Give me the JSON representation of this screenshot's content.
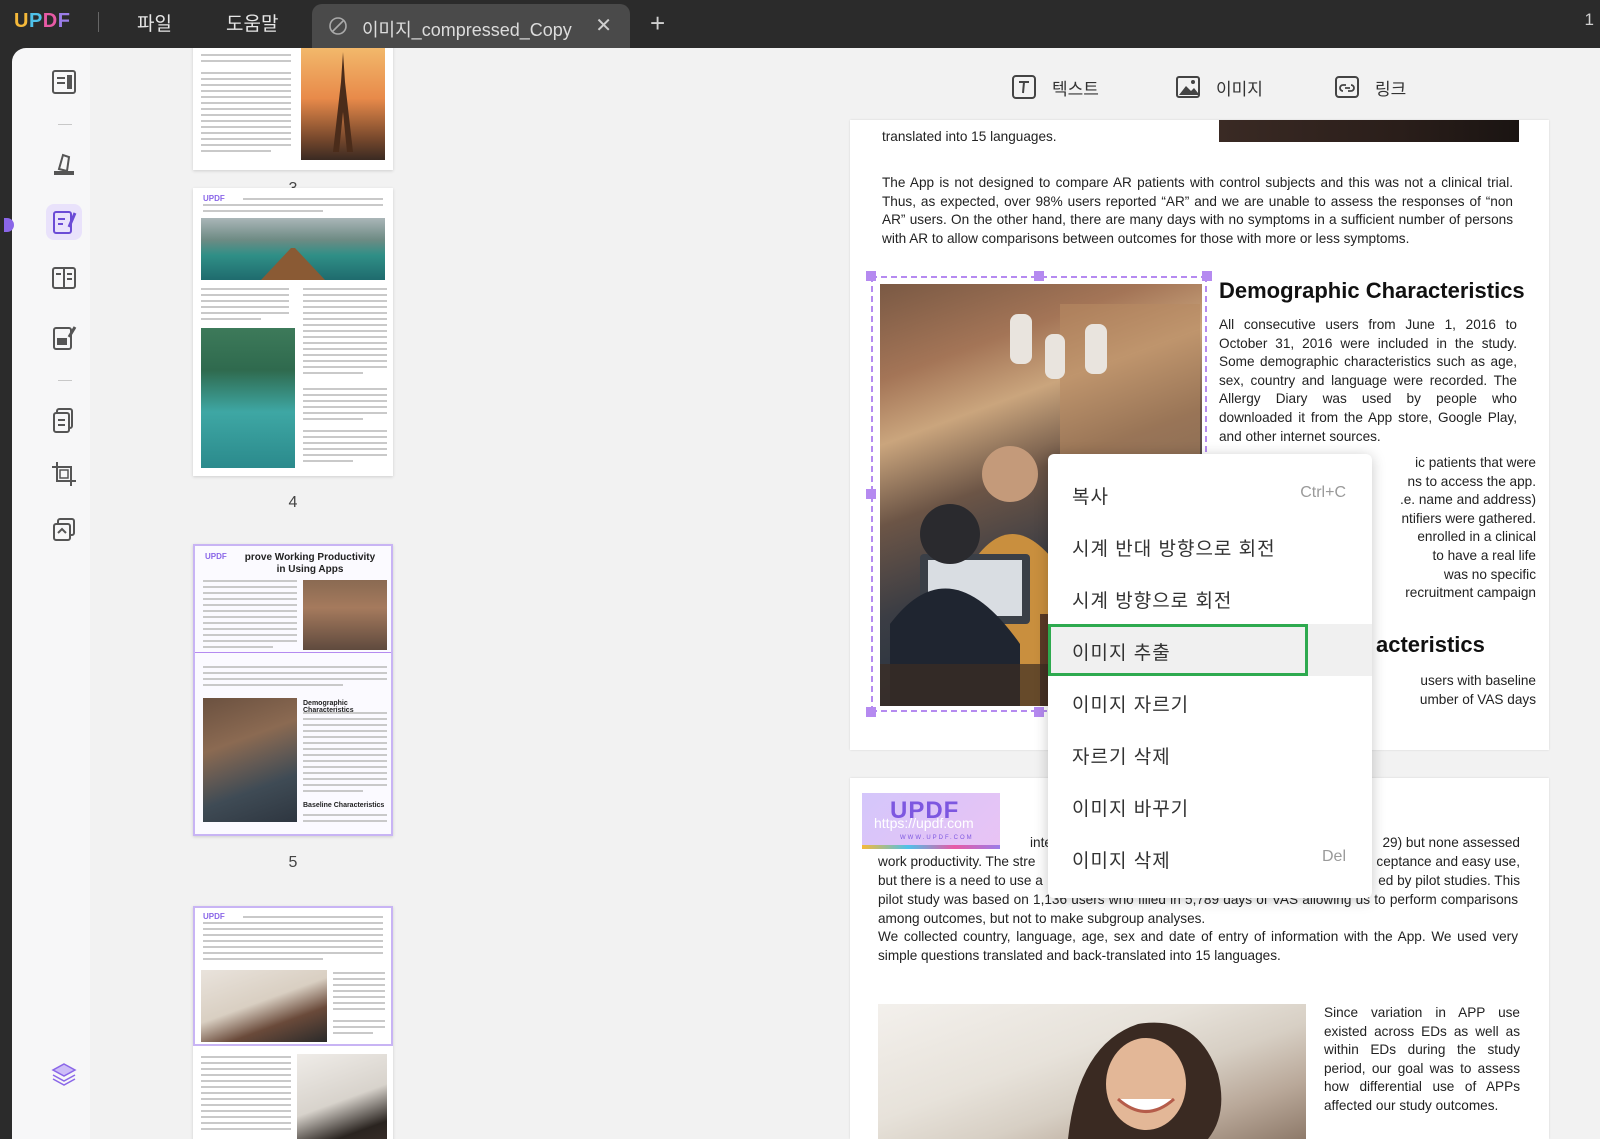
{
  "app": {
    "brand": "UPDF",
    "menu_file": "파일",
    "menu_help": "도움말",
    "tab_title": "이미지_compressed_Copy",
    "tab_close": "✕",
    "new_tab": "+",
    "right_indicator": "1"
  },
  "sidebar": {
    "tools": [
      "reader-icon",
      "comment-icon",
      "edit-icon",
      "organize-icon",
      "form-icon",
      "convert-icon",
      "crop-icon",
      "batch-icon",
      "layers-icon"
    ]
  },
  "thumbnails": {
    "pages": [
      {
        "number": "3"
      },
      {
        "number": "4"
      },
      {
        "number": "5",
        "title_line1": "prove Working Productivity",
        "title_line2": "in Using Apps",
        "subheading": "Demographic Characteristics",
        "subheading2": "Baseline Characteristics"
      },
      {
        "number": ""
      }
    ],
    "logo": "UPDF"
  },
  "edit_toolbar": {
    "text": "텍스트",
    "image": "이미지",
    "link": "링크"
  },
  "document": {
    "top_line": "translated into 15 languages.",
    "para1": "The App is not designed to compare AR patients with control subjects and this was not a clinical trial. Thus, as expected, over 98% users reported “AR” and we are unable to assess the responses of “non AR” users. On the other hand, there are many days with no symptoms in a sufficient number of persons with AR to allow comparisons between outcomes for those with more or less symptoms.",
    "heading1": "Demographic Characteristics",
    "para2": "All consecutive users from June 1, 2016 to October 31, 2016 were included in the study. Some demographic characteristics such as age, sex, country and language were recorded. The Allergy Diary was used by people who downloaded it from the App store, Google Play, and other internet sources.",
    "para3_frag": [
      "ic patients that were",
      "ns to access the app.",
      ".e. name and address)",
      "ntifiers were gathered.",
      "enrolled in a clinical",
      "to have a real life",
      "was    no    specific",
      "recruitment campaign"
    ],
    "heading2_frag": "acteristics",
    "para4_frag": [
      "users   with   baseline",
      "umber of VAS days"
    ],
    "page2_frag_left": "internet",
    "page2_frag_right": "29) but none assessed",
    "page2_line2_left": "work productivity. The stre",
    "page2_line2_right": "ceptance and easy use,",
    "page2_line3_left": "but there is a need to use a",
    "page2_line3_right": "ed by pilot studies. This",
    "page2_para": "pilot study was based on 1,136 users who filled in 5,789 days of VAS allowing us to perform comparisons among outcomes, but not to make subgroup analyses.",
    "page2_para2": "We collected country, language, age, sex and date of entry of information with the App. We used very simple questions translated and back-translated into 15 languages.",
    "page2_para3": "Since variation in APP use existed across EDs as well as within EDs during the study period, our goal was to assess how differential use of APPs affected our study outcomes.",
    "watermark_url": "https://updf.com",
    "watermark_brand": "UPDF",
    "watermark_sub": "WWW.UPDF.COM"
  },
  "context_menu": {
    "items": [
      {
        "label": "복사",
        "shortcut": "Ctrl+C"
      },
      {
        "label": "시계 반대 방향으로 회전",
        "shortcut": ""
      },
      {
        "label": "시계 방향으로 회전",
        "shortcut": ""
      },
      {
        "label": "이미지 추출",
        "shortcut": ""
      },
      {
        "label": "이미지 자르기",
        "shortcut": ""
      },
      {
        "label": "자르기 삭제",
        "shortcut": ""
      },
      {
        "label": "이미지 바꾸기",
        "shortcut": ""
      },
      {
        "label": "이미지 삭제",
        "shortcut": "Del"
      }
    ],
    "highlighted_index": 3,
    "highlight_color": "#2eaa4f"
  },
  "colors": {
    "accent": "#8a66e8",
    "selection": "#b58af0",
    "titlebar": "#2b2b2b"
  }
}
